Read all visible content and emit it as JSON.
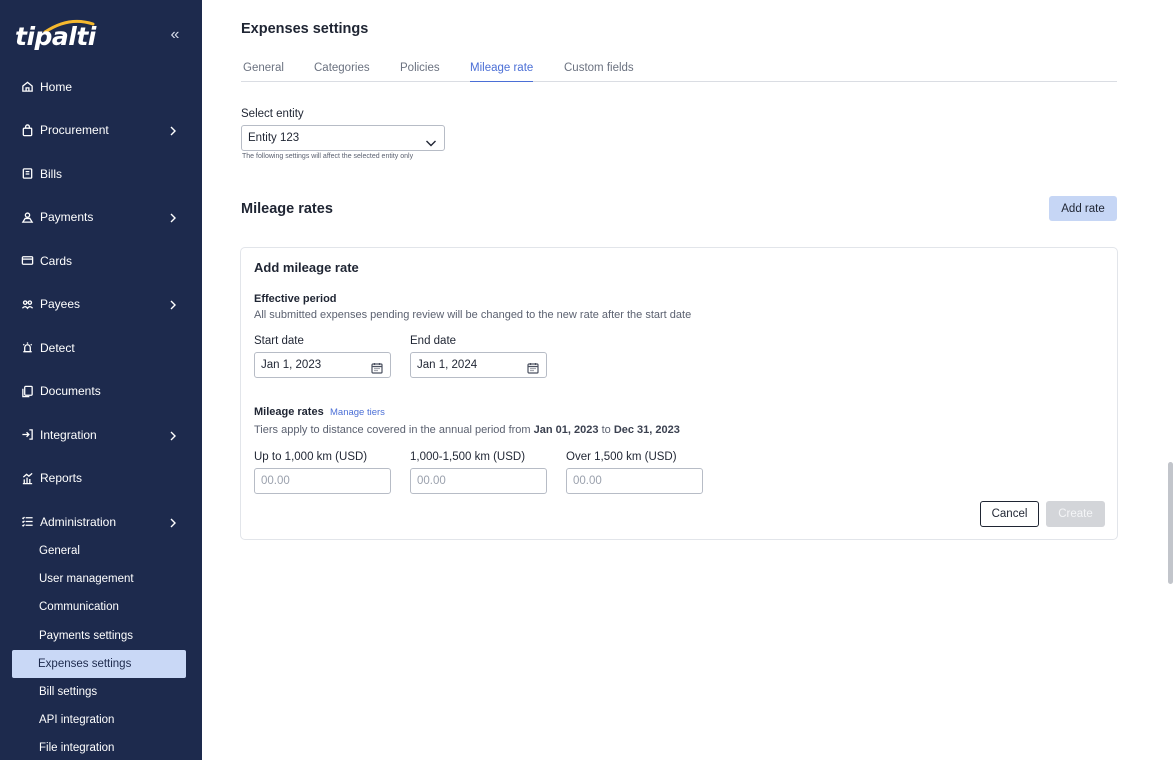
{
  "sidebar": {
    "logo": "tipalti",
    "collapse": "«",
    "items": [
      {
        "label": "Home",
        "icon": "home-icon",
        "has_children": false
      },
      {
        "label": "Procurement",
        "icon": "bag-icon",
        "has_children": true
      },
      {
        "label": "Bills",
        "icon": "bill-icon",
        "has_children": false
      },
      {
        "label": "Payments",
        "icon": "payments-icon",
        "has_children": true
      },
      {
        "label": "Cards",
        "icon": "card-icon",
        "has_children": false
      },
      {
        "label": "Payees",
        "icon": "payees-icon",
        "has_children": true
      },
      {
        "label": "Detect",
        "icon": "detect-icon",
        "has_children": false
      },
      {
        "label": "Documents",
        "icon": "documents-icon",
        "has_children": false
      },
      {
        "label": "Integration",
        "icon": "integration-icon",
        "has_children": true
      },
      {
        "label": "Reports",
        "icon": "reports-icon",
        "has_children": false
      },
      {
        "label": "Administration",
        "icon": "administration-icon",
        "has_children": true
      }
    ],
    "sub_items": [
      {
        "label": "General",
        "active": false
      },
      {
        "label": "User management",
        "active": false
      },
      {
        "label": "Communication",
        "active": false
      },
      {
        "label": "Payments settings",
        "active": false
      },
      {
        "label": "Expenses settings",
        "active": true
      },
      {
        "label": "Bill settings",
        "active": false
      },
      {
        "label": "API integration",
        "active": false
      },
      {
        "label": "File integration",
        "active": false
      }
    ]
  },
  "page": {
    "title": "Expenses settings",
    "tabs": [
      {
        "label": "General",
        "active": false
      },
      {
        "label": "Categories",
        "active": false
      },
      {
        "label": "Policies",
        "active": false
      },
      {
        "label": "Mileage rate",
        "active": true
      },
      {
        "label": "Custom fields",
        "active": false
      }
    ],
    "entity": {
      "label": "Select entity",
      "value": "Entity 123",
      "help": "The following settings will affect the selected entity only"
    },
    "section_title": "Mileage rates",
    "add_rate_label": "Add rate"
  },
  "form": {
    "title": "Add mileage rate",
    "effective_title": "Effective period",
    "effective_desc": "All submitted expenses pending review will be changed to the new rate after the start date",
    "start_label": "Start date",
    "start_value": "Jan 1, 2023",
    "end_label": "End date",
    "end_value": "Jan 1, 2024",
    "rates_title": "Mileage rates",
    "manage_tiers": "Manage tiers",
    "tiers_desc_prefix": "Tiers apply to distance covered in the annual period from",
    "tiers_from": "Jan 01, 2023",
    "tiers_to_word": "to",
    "tiers_to": "Dec 31, 2023",
    "tiers": [
      {
        "label": "Up to 1,000 km (USD)",
        "placeholder": "00.00"
      },
      {
        "label": "1,000-1,500 km (USD)",
        "placeholder": "00.00"
      },
      {
        "label": "Over 1,500 km (USD)",
        "placeholder": "00.00"
      }
    ],
    "cancel_label": "Cancel",
    "create_label": "Create"
  },
  "colors": {
    "sidebar_bg": "#1d2a4d",
    "accent": "#4b6fd6",
    "active_sub_bg": "#c9d8f6",
    "add_rate_bg": "#c6d6f5",
    "logo_swoosh": "#f5b82e"
  }
}
